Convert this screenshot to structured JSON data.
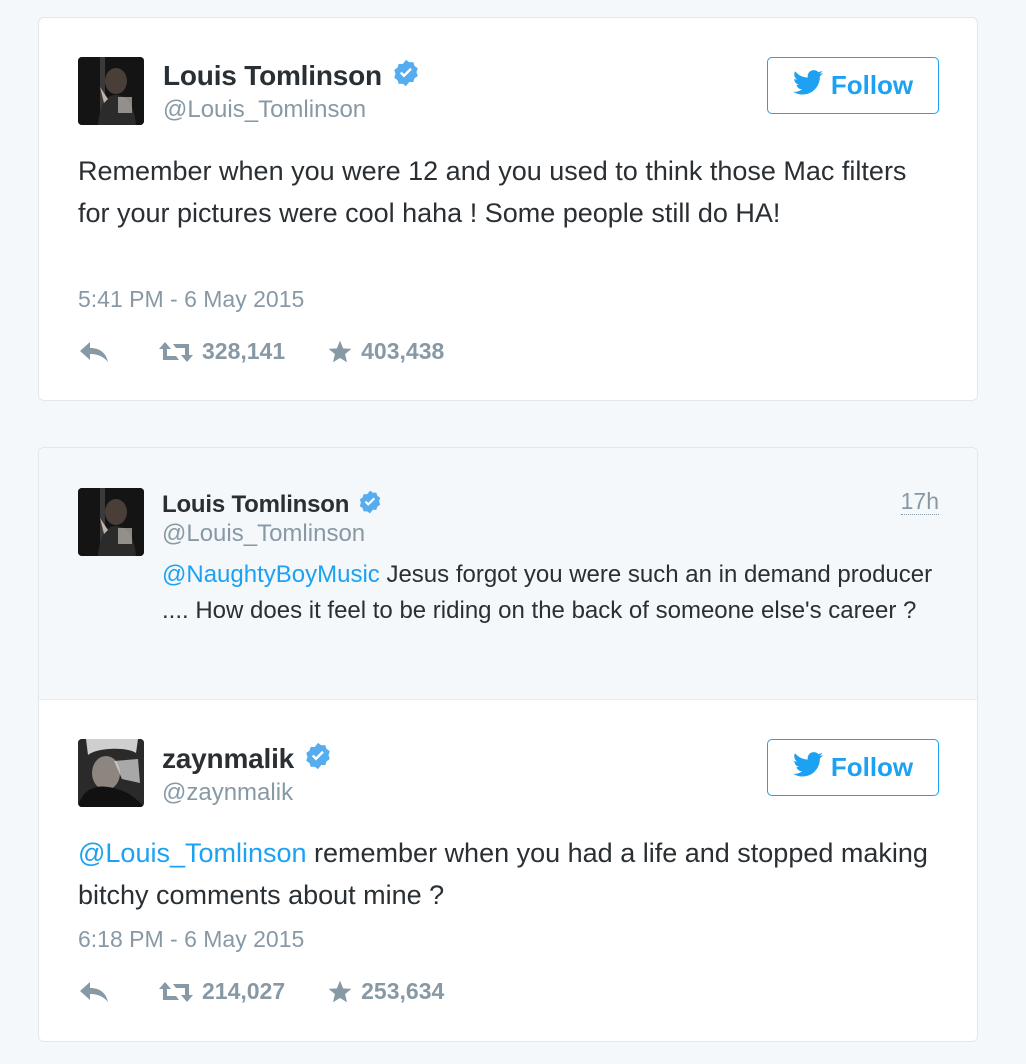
{
  "tweet1": {
    "display_name": "Louis Tomlinson",
    "handle": "@Louis_Tomlinson",
    "follow_label": "Follow",
    "text": "Remember when you were 12 and you used to think those Mac filters for your pictures were cool haha ! Some people still do HA!",
    "timestamp": "5:41 PM - 6 May 2015",
    "retweets": "328,141",
    "favorites": "403,438"
  },
  "tweet2": {
    "quoted": {
      "display_name": "Louis Tomlinson",
      "handle": "@Louis_Tomlinson",
      "relative_time": "17h",
      "mention": "@NaughtyBoyMusic",
      "text": " Jesus forgot you were such an in demand producer .... How does it feel to be riding on the back of someone else's career ?"
    },
    "display_name": "zaynmalik",
    "handle": "@zaynmalik",
    "follow_label": "Follow",
    "mention": "@Louis_Tomlinson",
    "text": " remember when you had a life and stopped making bitchy comments about mine ?",
    "timestamp": "6:18 PM - 6 May 2015",
    "retweets": "214,027",
    "favorites": "253,634"
  },
  "icons": {
    "verified": "verified-badge-icon",
    "follow": "twitter-bird-icon",
    "reply": "reply-icon",
    "retweet": "retweet-icon",
    "favorite": "star-icon"
  },
  "colors": {
    "link": "#1da1f2",
    "verified": "#55acee",
    "muted": "#8899a6",
    "text": "#292f33",
    "quoted_bg": "#f5f8fa"
  }
}
